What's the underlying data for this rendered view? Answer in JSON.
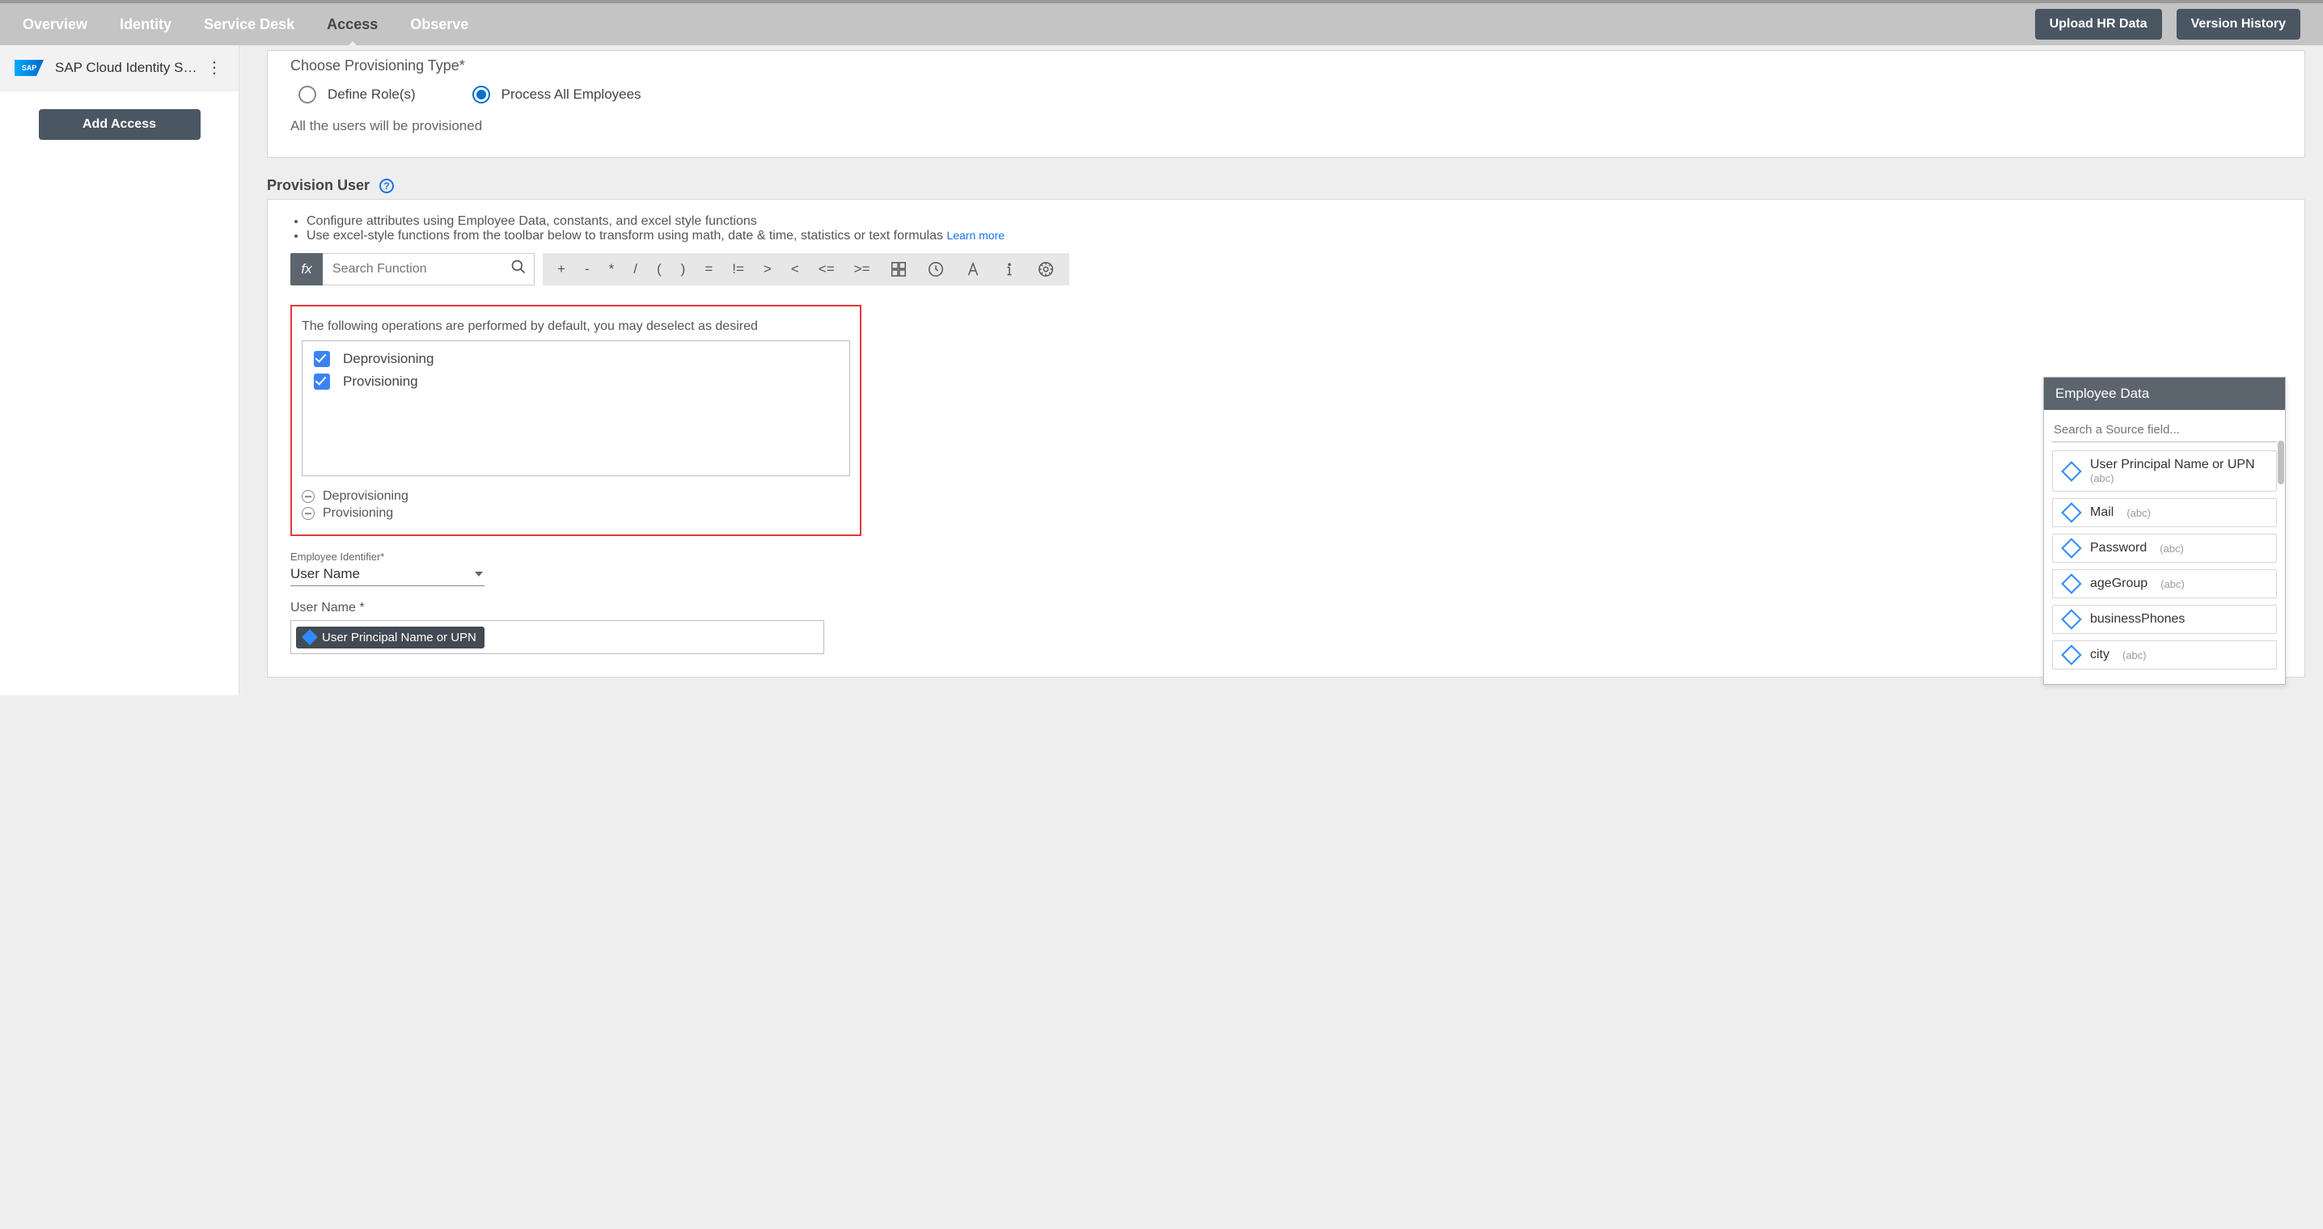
{
  "topnav": {
    "items": [
      "Overview",
      "Identity",
      "Service Desk",
      "Access",
      "Observe"
    ],
    "active": "Access"
  },
  "topbar": {
    "upload": "Upload HR Data",
    "history": "Version History"
  },
  "sidebar": {
    "app_name": "SAP Cloud Identity S…",
    "add_access": "Add Access"
  },
  "prov_type": {
    "title": "Choose Provisioning Type*",
    "opt_define": "Define Role(s)",
    "opt_all": "Process All Employees",
    "hint": "All the users will be provisioned"
  },
  "section": {
    "title": "Provision User"
  },
  "info": {
    "b1": "Configure attributes using Employee Data, constants, and excel style functions",
    "b2": "Use excel-style functions from the toolbar below to transform using math, date & time, statistics or text formulas",
    "learn": "Learn more"
  },
  "fx": {
    "label": "fx",
    "placeholder": "Search Function",
    "ops": [
      "+",
      "-",
      "*",
      "/",
      "(",
      ")",
      "=",
      "!=",
      ">",
      "<",
      "<=",
      ">="
    ]
  },
  "opsbox": {
    "desc": "The following operations are performed by default, you may deselect as desired",
    "chk1": "Deprovisioning",
    "chk2": "Provisioning",
    "sel1": "Deprovisioning",
    "sel2": "Provisioning"
  },
  "fields": {
    "emp_id_label": "Employee Identifier*",
    "emp_id_value": "User Name",
    "username_label": "User Name *",
    "chip_text": "User Principal Name or UPN"
  },
  "emp_panel": {
    "title": "Employee Data",
    "search_ph": "Search a Source field...",
    "items": [
      {
        "name": "User Principal Name or UPN",
        "type": "(abc)",
        "stacked": true
      },
      {
        "name": "Mail",
        "type": "(abc)"
      },
      {
        "name": "Password",
        "type": "(abc)"
      },
      {
        "name": "ageGroup",
        "type": "(abc)"
      },
      {
        "name": "businessPhones",
        "type": ""
      },
      {
        "name": "city",
        "type": "(abc)"
      }
    ]
  }
}
